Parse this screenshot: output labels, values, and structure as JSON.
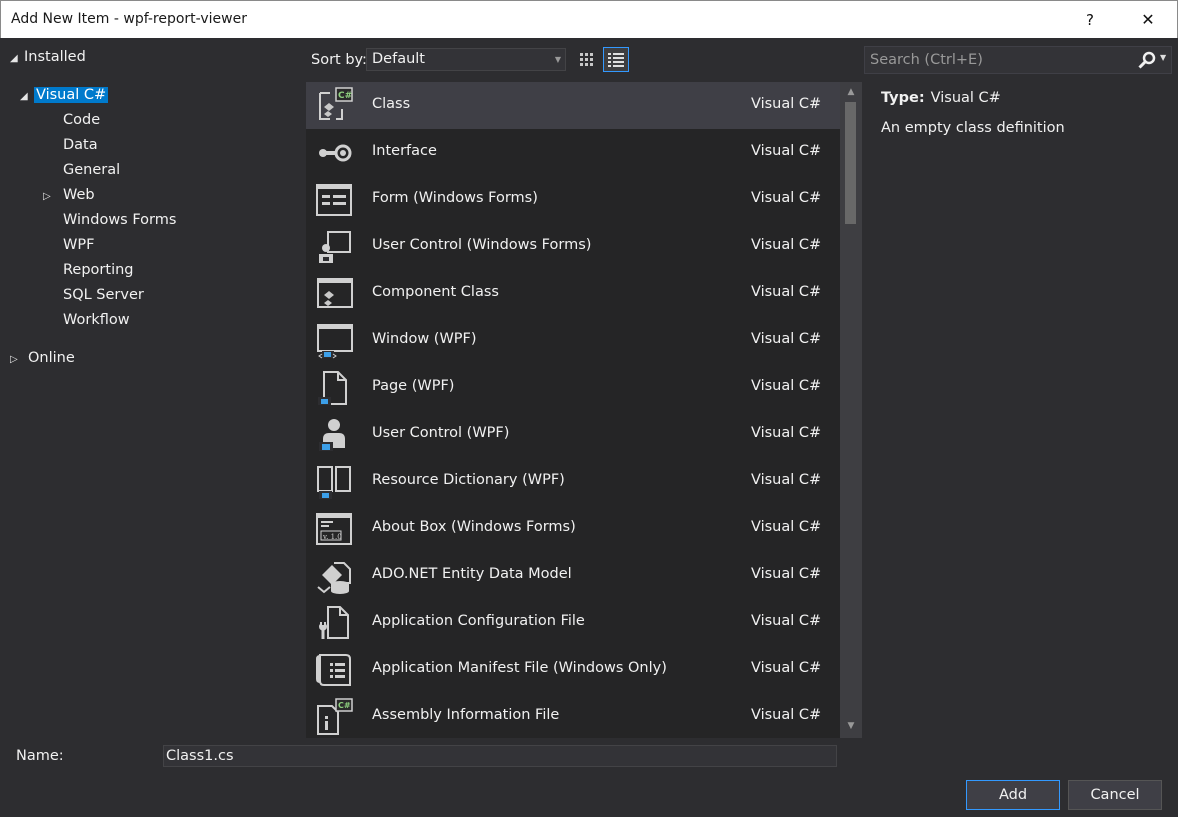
{
  "window": {
    "title": "Add New Item - wpf-report-viewer",
    "help_label": "?",
    "close_label": "✕"
  },
  "tree": {
    "installed": "Installed",
    "visual_csharp": "Visual C#",
    "children": [
      "Code",
      "Data",
      "General",
      "Web",
      "Windows Forms",
      "WPF",
      "Reporting",
      "SQL Server",
      "Workflow"
    ],
    "online": "Online"
  },
  "sort": {
    "label": "Sort by:",
    "value": "Default"
  },
  "search": {
    "placeholder": "Search (Ctrl+E)"
  },
  "templates": [
    {
      "name": "Class",
      "lang": "Visual C#",
      "icon": "class-icon"
    },
    {
      "name": "Interface",
      "lang": "Visual C#",
      "icon": "interface-icon"
    },
    {
      "name": "Form (Windows Forms)",
      "lang": "Visual C#",
      "icon": "form-icon"
    },
    {
      "name": "User Control (Windows Forms)",
      "lang": "Visual C#",
      "icon": "user-control-icon"
    },
    {
      "name": "Component Class",
      "lang": "Visual C#",
      "icon": "component-icon"
    },
    {
      "name": "Window (WPF)",
      "lang": "Visual C#",
      "icon": "window-icon"
    },
    {
      "name": "Page (WPF)",
      "lang": "Visual C#",
      "icon": "page-icon"
    },
    {
      "name": "User Control (WPF)",
      "lang": "Visual C#",
      "icon": "wpf-user-control-icon"
    },
    {
      "name": "Resource Dictionary (WPF)",
      "lang": "Visual C#",
      "icon": "resource-dictionary-icon"
    },
    {
      "name": "About Box (Windows Forms)",
      "lang": "Visual C#",
      "icon": "about-box-icon"
    },
    {
      "name": "ADO.NET Entity Data Model",
      "lang": "Visual C#",
      "icon": "entity-model-icon"
    },
    {
      "name": "Application Configuration File",
      "lang": "Visual C#",
      "icon": "config-file-icon"
    },
    {
      "name": "Application Manifest File (Windows Only)",
      "lang": "Visual C#",
      "icon": "manifest-icon"
    },
    {
      "name": "Assembly Information File",
      "lang": "Visual C#",
      "icon": "assembly-info-icon"
    }
  ],
  "details": {
    "type_label": "Type:",
    "type_value": "Visual C#",
    "description": "An empty class definition"
  },
  "name_field": {
    "label": "Name:",
    "value": "Class1.cs"
  },
  "buttons": {
    "add": "Add",
    "cancel": "Cancel"
  },
  "colors": {
    "accent": "#007acc",
    "background": "#2d2d30",
    "list_bg": "#252526",
    "selected_row": "#3f3f46"
  }
}
